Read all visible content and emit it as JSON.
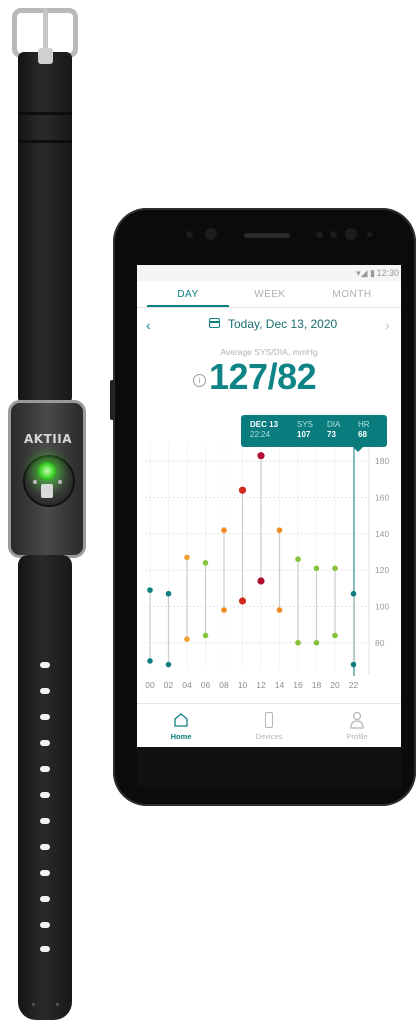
{
  "bracelet": {
    "brand": "AKTIIA"
  },
  "status_bar": {
    "time": "12:30"
  },
  "tabs": [
    {
      "label": "DAY",
      "active": true
    },
    {
      "label": "WEEK",
      "active": false
    },
    {
      "label": "MONTH",
      "active": false
    }
  ],
  "date_nav": {
    "prev": "‹",
    "date": "Today, Dec 13, 2020",
    "next": "›"
  },
  "summary": {
    "label": "Average SYS/DIA, mmHg",
    "value": "127/82",
    "info": "i"
  },
  "tooltip": {
    "date": "DEC 13",
    "time": "22:24",
    "sys_label": "SYS",
    "sys": "107",
    "dia_label": "DIA",
    "dia": "73",
    "hr_label": "HR",
    "hr": "68"
  },
  "chart_data": {
    "type": "scatter",
    "x_ticks": [
      "00",
      "02",
      "04",
      "06",
      "08",
      "10",
      "12",
      "14",
      "16",
      "18",
      "20",
      "22"
    ],
    "y_ticks": [
      "180",
      "160",
      "140",
      "120",
      "100",
      "80"
    ],
    "ylim": [
      65,
      190
    ],
    "points": [
      {
        "hour": 0,
        "sys": 109,
        "dia": 70,
        "color": "#0e7f80"
      },
      {
        "hour": 2,
        "sys": 107,
        "dia": 68,
        "color": "#0e7f80"
      },
      {
        "hour": 4,
        "sys": 127,
        "dia": 82,
        "color": "#f0a030"
      },
      {
        "hour": 6,
        "sys": 124,
        "dia": 84,
        "color": "#86c23a"
      },
      {
        "hour": 8,
        "sys": 142,
        "dia": 98,
        "color": "#f08a1e"
      },
      {
        "hour": 10,
        "sys": 164,
        "dia": 103,
        "color": "#d02a1c"
      },
      {
        "hour": 12,
        "sys": 183,
        "dia": 114,
        "color": "#b01030"
      },
      {
        "hour": 14,
        "sys": 142,
        "dia": 98,
        "color": "#f08a1e"
      },
      {
        "hour": 16,
        "sys": 126,
        "dia": 80,
        "color": "#86c23a"
      },
      {
        "hour": 18,
        "sys": 121,
        "dia": 80,
        "color": "#86c23a"
      },
      {
        "hour": 20,
        "sys": 121,
        "dia": 84,
        "color": "#86c23a"
      },
      {
        "hour": 22,
        "sys": 107,
        "dia": 68,
        "color": "#0e7f80"
      }
    ],
    "grid": true
  },
  "bottom_nav": [
    {
      "label": "Home",
      "active": true
    },
    {
      "label": "Devices",
      "active": false
    },
    {
      "label": "Profile",
      "active": false
    }
  ],
  "colors": {
    "accent": "#0c7f80",
    "inactive": "#b4b4b4"
  }
}
